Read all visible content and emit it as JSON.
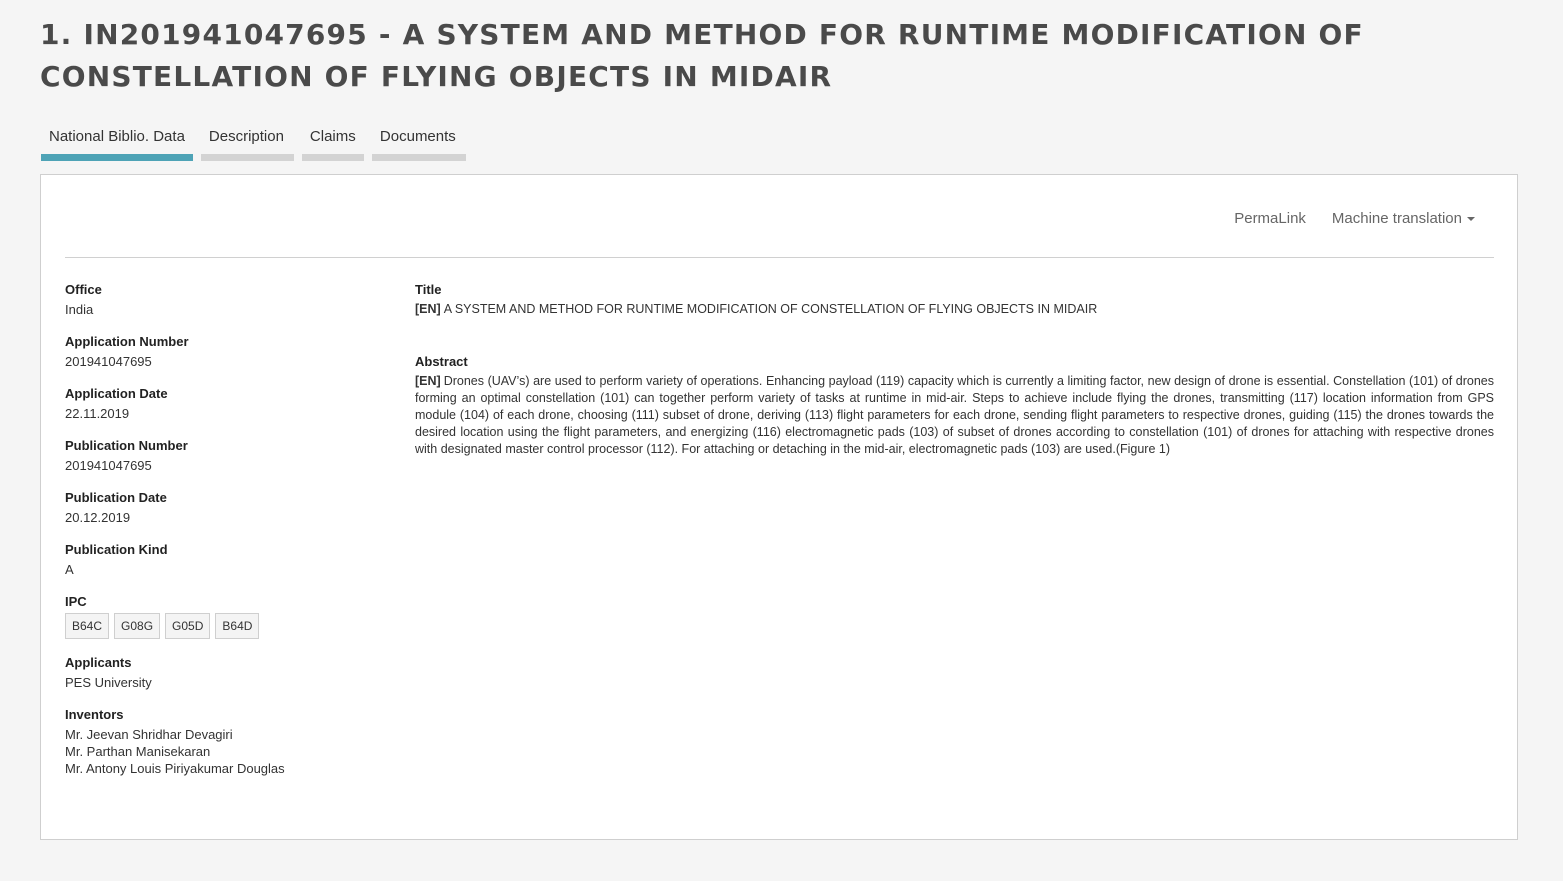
{
  "page": {
    "title": "1. IN201941047695 - A SYSTEM AND METHOD FOR RUNTIME MODIFICATION OF CONSTELLATION OF FLYING OBJECTS IN MIDAIR"
  },
  "tabs": [
    {
      "label": "National Biblio. Data",
      "active": true
    },
    {
      "label": "Description",
      "active": false
    },
    {
      "label": "Claims",
      "active": false
    },
    {
      "label": "Documents",
      "active": false
    }
  ],
  "toolbar": {
    "permalink": "PermaLink",
    "machine_translation": "Machine translation"
  },
  "biblio": {
    "office": {
      "label": "Office",
      "value": "India"
    },
    "application_number": {
      "label": "Application Number",
      "value": "201941047695"
    },
    "application_date": {
      "label": "Application Date",
      "value": "22.11.2019"
    },
    "publication_number": {
      "label": "Publication Number",
      "value": "201941047695"
    },
    "publication_date": {
      "label": "Publication Date",
      "value": "20.12.2019"
    },
    "publication_kind": {
      "label": "Publication Kind",
      "value": "A"
    },
    "ipc": {
      "label": "IPC",
      "codes": [
        "B64C",
        "G08G",
        "G05D",
        "B64D"
      ]
    },
    "applicants": {
      "label": "Applicants",
      "value": "PES University"
    },
    "inventors": {
      "label": "Inventors",
      "names": [
        "Mr. Jeevan Shridhar Devagiri",
        "Mr. Parthan Manisekaran",
        "Mr. Antony Louis Piriyakumar Douglas"
      ]
    }
  },
  "title_section": {
    "label": "Title",
    "lang": "[EN]",
    "text": "A SYSTEM AND METHOD FOR RUNTIME MODIFICATION OF CONSTELLATION OF FLYING OBJECTS IN MIDAIR"
  },
  "abstract_section": {
    "label": "Abstract",
    "lang": "[EN]",
    "text": "Drones (UAV’s) are used to perform variety of operations. Enhancing payload (119) capacity which is currently a limiting factor, new design of drone is essential. Constellation (101) of drones forming an optimal constellation (101) can together perform variety of tasks at runtime in mid-air. Steps to achieve include flying the drones, transmitting (117) location information from GPS module (104) of each drone, choosing (111) subset of drone, deriving (113) flight parameters for each drone, sending flight parameters to respective drones, guiding (115) the drones towards the desired location using the flight parameters, and energizing (116) electromagnetic pads (103) of subset of drones according to constellation (101) of drones for attaching with respective drones with designated master control processor (112). For attaching or detaching in the mid-air, electromagnetic pads (103) are used.(Figure 1)"
  },
  "colors": {
    "active_tab": "#4ea3b6",
    "inactive_tab": "#d3d3d3",
    "title": "#4a4a4a"
  }
}
